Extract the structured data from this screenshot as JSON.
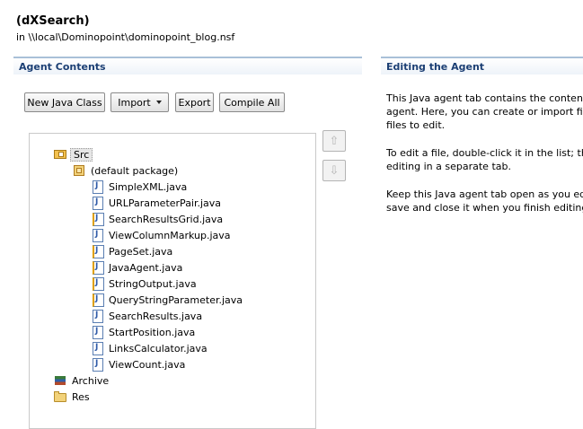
{
  "header": {
    "title": "(dXSearch)",
    "path": "in \\\\local\\Dominopoint\\dominopoint_blog.nsf"
  },
  "left_panel": {
    "title": "Agent Contents",
    "toolbar": {
      "new_java_class": "New Java Class",
      "import": "Import",
      "export": "Export",
      "compile_all": "Compile All"
    },
    "tree": {
      "src": "Src",
      "default_package": "(default package)",
      "files": [
        {
          "name": "SimpleXML.java",
          "warning": false
        },
        {
          "name": "URLParameterPair.java",
          "warning": false
        },
        {
          "name": "SearchResultsGrid.java",
          "warning": true
        },
        {
          "name": "ViewColumnMarkup.java",
          "warning": false
        },
        {
          "name": "PageSet.java",
          "warning": true
        },
        {
          "name": "JavaAgent.java",
          "warning": true
        },
        {
          "name": "StringOutput.java",
          "warning": true
        },
        {
          "name": "QueryStringParameter.java",
          "warning": true
        },
        {
          "name": "SearchResults.java",
          "warning": false
        },
        {
          "name": "StartPosition.java",
          "warning": false
        },
        {
          "name": "LinksCalculator.java",
          "warning": false
        },
        {
          "name": "ViewCount.java",
          "warning": false
        }
      ],
      "archive": "Archive",
      "res": "Res"
    },
    "move_up_icon": "arrow-up",
    "move_down_icon": "arrow-down"
  },
  "right_panel": {
    "title": "Editing the Agent",
    "paragraphs": [
      [
        "This Java agent tab contains the contents",
        "agent. Here, you can create or import files",
        "files to edit."
      ],
      [
        "To edit a file, double-click it in the list; the",
        "editing in a separate tab."
      ],
      [
        "Keep this Java agent tab open as you edit",
        "save and close it when you finish editing."
      ]
    ]
  },
  "colors": {
    "section_title": "#1c3f74",
    "section_rule": "#a9c0d8"
  }
}
